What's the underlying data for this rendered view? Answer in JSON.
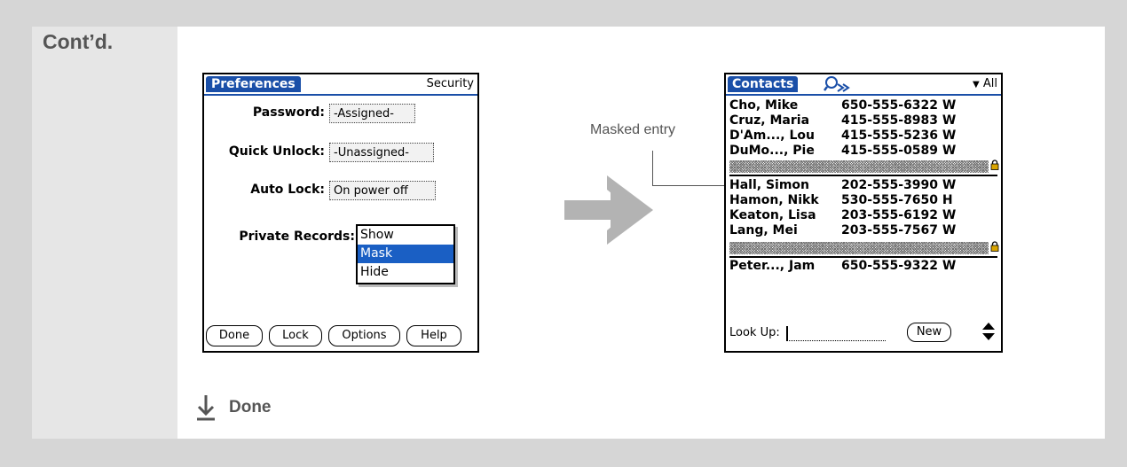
{
  "section_label": "Cont’d.",
  "preferences": {
    "title": "Preferences",
    "category": "Security",
    "password_label": "Password:",
    "password_value": "-Assigned-",
    "quick_unlock_label": "Quick Unlock:",
    "quick_unlock_value": "-Unassigned-",
    "auto_lock_label": "Auto Lock:",
    "auto_lock_value": "On power off",
    "private_records_label": "Private Records:",
    "private_records_options": [
      "Show",
      "Mask",
      "Hide"
    ],
    "private_records_selected": "Mask",
    "buttons": [
      "Done",
      "Lock",
      "Options",
      "Help"
    ]
  },
  "callout": {
    "text": "Masked entry"
  },
  "contacts": {
    "title": "Contacts",
    "category": "All",
    "rows": [
      {
        "name": "Cho, Mike",
        "phone": "650-555-6322",
        "type": "W"
      },
      {
        "name": "Cruz, Maria",
        "phone": "415-555-8983",
        "type": "W"
      },
      {
        "name": "D'Am..., Lou",
        "phone": "415-555-5236",
        "type": "W"
      },
      {
        "name": "DuMo..., Pie",
        "phone": "415-555-0589",
        "type": "W"
      },
      {
        "name": "Hall, Simon",
        "phone": "202-555-3990",
        "type": "W"
      },
      {
        "name": "Hamon, Nikk",
        "phone": "530-555-7650",
        "type": "H"
      },
      {
        "name": "Keaton, Lisa",
        "phone": "203-555-6192",
        "type": "W"
      },
      {
        "name": "Lang, Mei",
        "phone": "203-555-7567",
        "type": "W"
      },
      {
        "name": "Peter..., Jam",
        "phone": "650-555-9322",
        "type": "W"
      }
    ],
    "lookup_label": "Look Up:",
    "new_button": "New"
  },
  "footer": {
    "done_label": "Done"
  },
  "colors": {
    "palm_blue": "#1a4fa8",
    "selection_blue": "#1a5fc4",
    "arrow_gray": "#b3b3b3"
  }
}
